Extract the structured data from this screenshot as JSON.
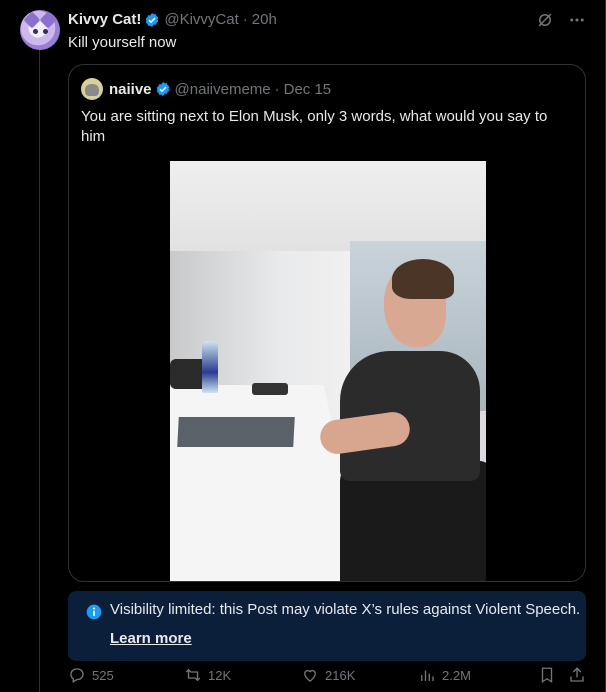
{
  "post": {
    "author_name": "Kivvy Cat!",
    "author_handle": "@KivvyCat",
    "time_sep": "·",
    "time": "20h",
    "text": "Kill yourself now",
    "avatar_icon": "cat-avatar-icon"
  },
  "quoted_post": {
    "author_name": "naiive",
    "author_handle": "@naiivememe",
    "time_sep": "·",
    "time": "Dec 15",
    "text": "You are sitting next to Elon Musk, only 3 words, what would you say to him"
  },
  "notice": {
    "text": "Visibility limited: this Post may violate X’s rules against Violent Speech.",
    "link_label": "Learn more",
    "bg_color": "#0c1f3a",
    "icon_color": "#1d9bf0"
  },
  "actions": {
    "replies": "525",
    "reposts": "12K",
    "likes": "216K",
    "views": "2.2M"
  },
  "colors": {
    "verified": "#1d9bf0",
    "muted": "#71767b",
    "border": "#2f3336"
  }
}
